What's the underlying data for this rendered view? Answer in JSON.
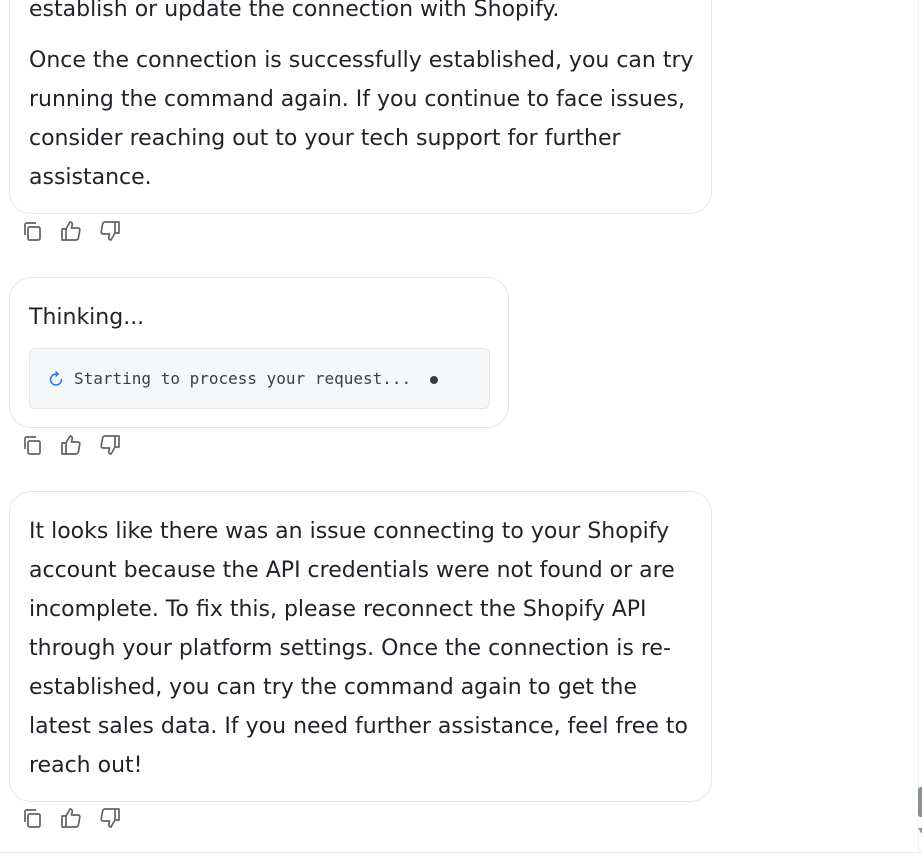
{
  "messages": [
    {
      "role": "assistant",
      "paragraphs": [
        "establish or update the connection with Shopify.",
        "Once the connection is successfully established, you can try running the command again. If you continue to face issues, consider reaching out to your tech support for further assistance."
      ]
    },
    {
      "role": "assistant",
      "title": "Thinking...",
      "status_text": "Starting to process your request..."
    },
    {
      "role": "assistant",
      "paragraphs": [
        "It looks like there was an issue connecting to your Shopify account because the API credentials were not found or are incomplete. To fix this, please reconnect the Shopify API through your platform settings. Once the connection is re-established, you can try the command again to get the latest sales data. If you need further assistance, feel free to reach out!"
      ]
    }
  ],
  "icons": {
    "copy": "copy-icon",
    "like": "thumbs-up-icon",
    "dislike": "thumbs-down-icon",
    "spinner": "loading-spinner-icon"
  },
  "colors": {
    "accent": "#1a73e8",
    "icon": "#5f6368",
    "bubble_border": "#e4e6ea",
    "status_bg": "#f6f7f9"
  }
}
